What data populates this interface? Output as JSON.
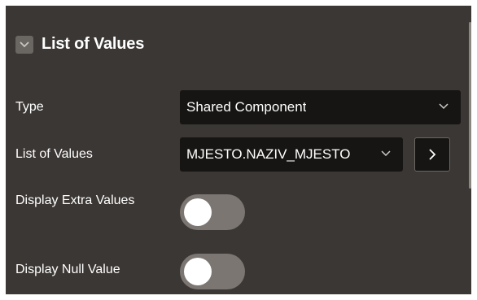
{
  "section": {
    "title": "List of Values",
    "collapse_icon": "chevron-down-icon"
  },
  "fields": {
    "type": {
      "label": "Type",
      "value": "Shared Component"
    },
    "list_of_values": {
      "label": "List of Values",
      "value": "MJESTO.NAZIV_MJESTO",
      "go_icon": "chevron-right-icon"
    },
    "display_extra_values": {
      "label": "Display Extra Values",
      "checked": false
    },
    "display_null_value": {
      "label": "Display Null Value",
      "checked": false
    }
  },
  "colors": {
    "panel_bg": "#3b3734",
    "field_bg": "#161513",
    "toggle_off": "#7b7672"
  }
}
